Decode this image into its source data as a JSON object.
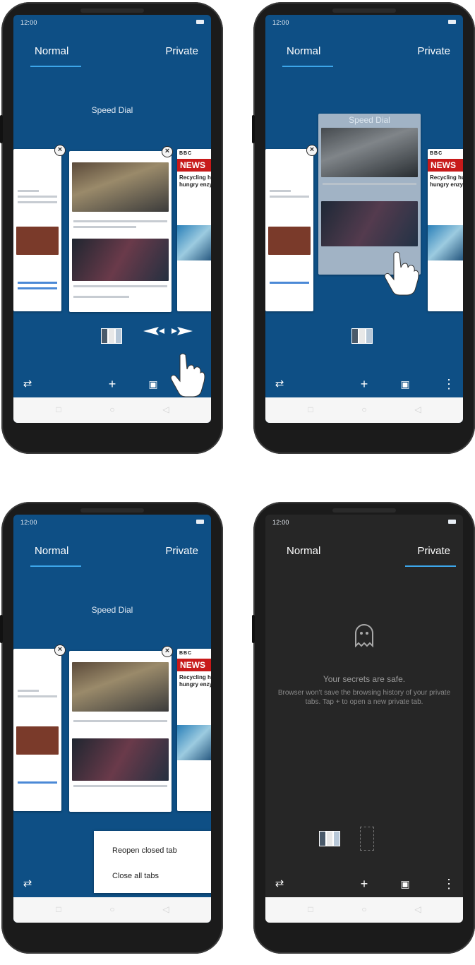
{
  "status": {
    "time": "12:00"
  },
  "tabs": {
    "normal": "Normal",
    "private": "Private"
  },
  "speed_dial": "Speed Dial",
  "news": {
    "badge": "NEWS",
    "logo": "BBC",
    "headline1": "Recycling hu",
    "headline2": "hungry enzym"
  },
  "menu": {
    "reopen": "Reopen closed tab",
    "close_all": "Close all tabs"
  },
  "private_empty": {
    "title": "Your secrets are safe.",
    "body": "Browser won't save the browsing history of your private tabs. Tap + to open a new private tab."
  },
  "toolbar": {
    "add": "+",
    "more": "⋮"
  },
  "colors": {
    "normal_bg": "#0e4f85",
    "private_bg": "#262626",
    "tab_accent": "#3da6ea",
    "news_red": "#c81a1a"
  },
  "icons": [
    "switch-icon",
    "add-icon",
    "tabs-icon",
    "more-icon",
    "close-icon",
    "ghost-icon",
    "back-icon",
    "home-icon",
    "recent-icon"
  ]
}
